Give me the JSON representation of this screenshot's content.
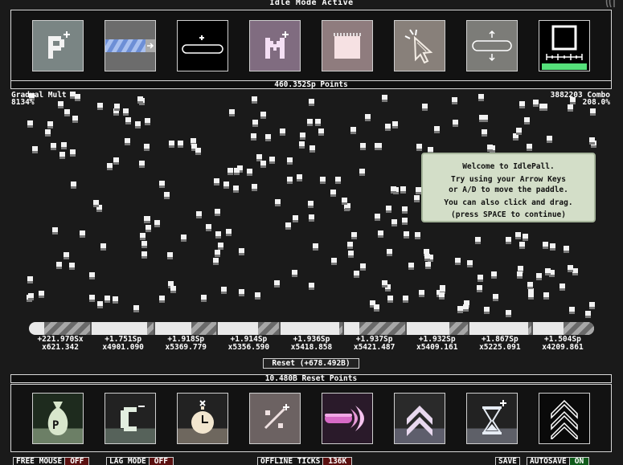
{
  "header": {
    "title": "Idle Mode Active"
  },
  "points_label": "460.352Sp Points",
  "stats": {
    "mode_name": "Gradual Mult",
    "mode_value": "8134%",
    "combo_label": "3882203 Combo",
    "combo_mult": "208.0%"
  },
  "dialog": {
    "line1": "Welcome to IdlePall.",
    "line2": "Try using your Arrow Keys",
    "line3": "or A/D to move the paddle.",
    "line4": "You can also click and drag.",
    "line5": "(press SPACE to continue)"
  },
  "multipliers": [
    {
      "sp": "+221.970Sx",
      "mult": "x621.342",
      "fill": 0.75
    },
    {
      "sp": "+1.751Sp",
      "mult": "x4901.090",
      "fill": 0.1
    },
    {
      "sp": "+1.918Sp",
      "mult": "x5369.779",
      "fill": 0.4
    },
    {
      "sp": "+1.914Sp",
      "mult": "x5356.590",
      "fill": 0.35
    },
    {
      "sp": "+1.936Sp",
      "mult": "x5418.858",
      "fill": 0.05
    },
    {
      "sp": "+1.937Sp",
      "mult": "x5421.487",
      "fill": 0.75
    },
    {
      "sp": "+1.932Sp",
      "mult": "x5409.161",
      "fill": 0.3
    },
    {
      "sp": "+1.867Sp",
      "mult": "x5225.091",
      "fill": 0.05
    },
    {
      "sp": "+1.504Sp",
      "mult": "x4209.861",
      "fill": 0.5
    }
  ],
  "reset_button": "Reset (+678.492B)",
  "reset_points_label": "10.480B Reset Points",
  "top_upgrades": [
    {
      "icon": "p-plus-icon"
    },
    {
      "icon": "striped-paddle-icon"
    },
    {
      "icon": "paddle-plus-icon"
    },
    {
      "icon": "m-plus-icon"
    },
    {
      "icon": "grid-box-icon"
    },
    {
      "icon": "cursor-click-icon"
    },
    {
      "icon": "paddle-resize-icon"
    },
    {
      "icon": "square-ruler-icon"
    }
  ],
  "bottom_upgrades": [
    {
      "icon": "money-bag-icon"
    },
    {
      "icon": "c-minus-icon"
    },
    {
      "icon": "clock-icon"
    },
    {
      "icon": "percent-plus-icon"
    },
    {
      "icon": "pink-bullet-icon"
    },
    {
      "icon": "double-chevron-icon"
    },
    {
      "icon": "hourglass-icon"
    },
    {
      "icon": "triple-chevron-icon"
    }
  ],
  "footer": {
    "free_mouse_label": "FREE MOUSE",
    "free_mouse_value": "OFF",
    "lag_mode_label": "LAG MODE",
    "lag_mode_value": "OFF",
    "offline_ticks_label": "OFFLINE TICKS",
    "offline_ticks_value": "136K",
    "save_label": "SAVE",
    "autosave_label": "AUTOSAVE",
    "autosave_value": "ON"
  },
  "colors": {
    "background": "#1a1a1a",
    "dialog_bg": "#d3dec8",
    "off_red": "#5a0f0f",
    "on_green": "#0f5a1a"
  }
}
